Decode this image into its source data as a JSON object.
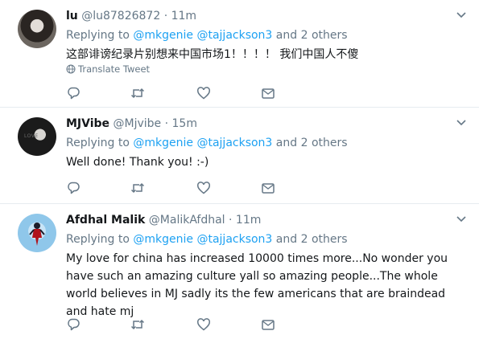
{
  "tweets": [
    {
      "name": "lu",
      "handle": "@lu87826872",
      "time": "11m",
      "replying_prefix": "Replying to",
      "mention_1": "@mkgenie",
      "mention_2": "@tajjackson3",
      "others": "and 2 others",
      "text": "这部诽谤纪录片别想来中国市场1！！！！ 我们中国人不傻",
      "translate_label": "Translate Tweet"
    },
    {
      "name": "MJVibe",
      "handle": "@Mjvibe",
      "time": "15m",
      "avatar_text": "LOVE",
      "replying_prefix": "Replying to",
      "mention_1": "@mkgenie",
      "mention_2": "@tajjackson3",
      "others": "and 2 others",
      "text": "Well done! Thank you! :-)"
    },
    {
      "name": "Afdhal Malik",
      "handle": "@MalikAfdhal",
      "time": "11m",
      "replying_prefix": "Replying to",
      "mention_1": "@mkgenie",
      "mention_2": "@tajjackson3",
      "others": "and 2 others",
      "text": "My love for china has increased 10000 times more...No wonder you have such an amazing culture yall so amazing people...The whole world believes in MJ sadly its the few americans that are braindead and hate mj"
    }
  ],
  "separator": "·",
  "icons": {
    "caret": "chevron-down-icon",
    "reply": "reply-icon",
    "retweet": "retweet-icon",
    "like": "heart-icon",
    "dm": "envelope-icon",
    "translate": "globe-icon"
  },
  "colors": {
    "link": "#1da1f2",
    "secondary": "#657786",
    "text": "#14171a",
    "border": "#e6ecf0"
  }
}
